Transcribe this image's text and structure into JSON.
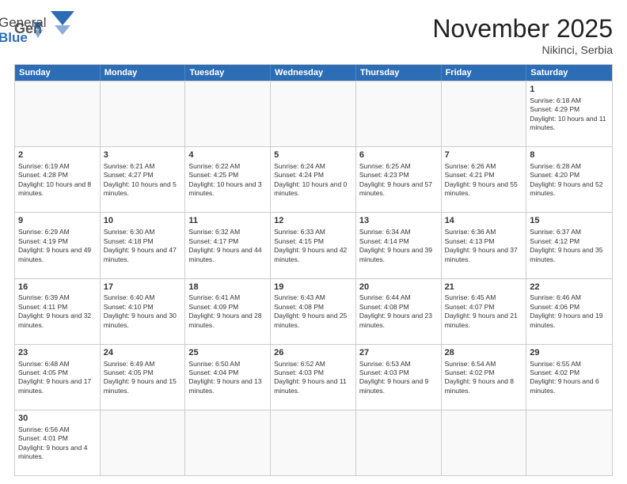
{
  "header": {
    "logo_general": "General",
    "logo_blue": "Blue",
    "month": "November 2025",
    "location": "Nikinci, Serbia"
  },
  "days_of_week": [
    "Sunday",
    "Monday",
    "Tuesday",
    "Wednesday",
    "Thursday",
    "Friday",
    "Saturday"
  ],
  "weeks": [
    [
      {
        "day": "",
        "empty": true
      },
      {
        "day": "",
        "empty": true
      },
      {
        "day": "",
        "empty": true
      },
      {
        "day": "",
        "empty": true
      },
      {
        "day": "",
        "empty": true
      },
      {
        "day": "",
        "empty": true
      },
      {
        "day": "1",
        "info": "Sunrise: 6:18 AM\nSunset: 4:29 PM\nDaylight: 10 hours and 11 minutes."
      }
    ],
    [
      {
        "day": "2",
        "info": "Sunrise: 6:19 AM\nSunset: 4:28 PM\nDaylight: 10 hours and 8 minutes."
      },
      {
        "day": "3",
        "info": "Sunrise: 6:21 AM\nSunset: 4:27 PM\nDaylight: 10 hours and 5 minutes."
      },
      {
        "day": "4",
        "info": "Sunrise: 6:22 AM\nSunset: 4:25 PM\nDaylight: 10 hours and 3 minutes."
      },
      {
        "day": "5",
        "info": "Sunrise: 6:24 AM\nSunset: 4:24 PM\nDaylight: 10 hours and 0 minutes."
      },
      {
        "day": "6",
        "info": "Sunrise: 6:25 AM\nSunset: 4:23 PM\nDaylight: 9 hours and 57 minutes."
      },
      {
        "day": "7",
        "info": "Sunrise: 6:26 AM\nSunset: 4:21 PM\nDaylight: 9 hours and 55 minutes."
      },
      {
        "day": "8",
        "info": "Sunrise: 6:28 AM\nSunset: 4:20 PM\nDaylight: 9 hours and 52 minutes."
      }
    ],
    [
      {
        "day": "9",
        "info": "Sunrise: 6:29 AM\nSunset: 4:19 PM\nDaylight: 9 hours and 49 minutes."
      },
      {
        "day": "10",
        "info": "Sunrise: 6:30 AM\nSunset: 4:18 PM\nDaylight: 9 hours and 47 minutes."
      },
      {
        "day": "11",
        "info": "Sunrise: 6:32 AM\nSunset: 4:17 PM\nDaylight: 9 hours and 44 minutes."
      },
      {
        "day": "12",
        "info": "Sunrise: 6:33 AM\nSunset: 4:15 PM\nDaylight: 9 hours and 42 minutes."
      },
      {
        "day": "13",
        "info": "Sunrise: 6:34 AM\nSunset: 4:14 PM\nDaylight: 9 hours and 39 minutes."
      },
      {
        "day": "14",
        "info": "Sunrise: 6:36 AM\nSunset: 4:13 PM\nDaylight: 9 hours and 37 minutes."
      },
      {
        "day": "15",
        "info": "Sunrise: 6:37 AM\nSunset: 4:12 PM\nDaylight: 9 hours and 35 minutes."
      }
    ],
    [
      {
        "day": "16",
        "info": "Sunrise: 6:39 AM\nSunset: 4:11 PM\nDaylight: 9 hours and 32 minutes."
      },
      {
        "day": "17",
        "info": "Sunrise: 6:40 AM\nSunset: 4:10 PM\nDaylight: 9 hours and 30 minutes."
      },
      {
        "day": "18",
        "info": "Sunrise: 6:41 AM\nSunset: 4:09 PM\nDaylight: 9 hours and 28 minutes."
      },
      {
        "day": "19",
        "info": "Sunrise: 6:43 AM\nSunset: 4:08 PM\nDaylight: 9 hours and 25 minutes."
      },
      {
        "day": "20",
        "info": "Sunrise: 6:44 AM\nSunset: 4:08 PM\nDaylight: 9 hours and 23 minutes."
      },
      {
        "day": "21",
        "info": "Sunrise: 6:45 AM\nSunset: 4:07 PM\nDaylight: 9 hours and 21 minutes."
      },
      {
        "day": "22",
        "info": "Sunrise: 6:46 AM\nSunset: 4:06 PM\nDaylight: 9 hours and 19 minutes."
      }
    ],
    [
      {
        "day": "23",
        "info": "Sunrise: 6:48 AM\nSunset: 4:05 PM\nDaylight: 9 hours and 17 minutes."
      },
      {
        "day": "24",
        "info": "Sunrise: 6:49 AM\nSunset: 4:05 PM\nDaylight: 9 hours and 15 minutes."
      },
      {
        "day": "25",
        "info": "Sunrise: 6:50 AM\nSunset: 4:04 PM\nDaylight: 9 hours and 13 minutes."
      },
      {
        "day": "26",
        "info": "Sunrise: 6:52 AM\nSunset: 4:03 PM\nDaylight: 9 hours and 11 minutes."
      },
      {
        "day": "27",
        "info": "Sunrise: 6:53 AM\nSunset: 4:03 PM\nDaylight: 9 hours and 9 minutes."
      },
      {
        "day": "28",
        "info": "Sunrise: 6:54 AM\nSunset: 4:02 PM\nDaylight: 9 hours and 8 minutes."
      },
      {
        "day": "29",
        "info": "Sunrise: 6:55 AM\nSunset: 4:02 PM\nDaylight: 9 hours and 6 minutes."
      }
    ],
    [
      {
        "day": "30",
        "info": "Sunrise: 6:56 AM\nSunset: 4:01 PM\nDaylight: 9 hours and 4 minutes."
      },
      {
        "day": "",
        "empty": true
      },
      {
        "day": "",
        "empty": true
      },
      {
        "day": "",
        "empty": true
      },
      {
        "day": "",
        "empty": true
      },
      {
        "day": "",
        "empty": true
      },
      {
        "day": "",
        "empty": true
      }
    ]
  ]
}
